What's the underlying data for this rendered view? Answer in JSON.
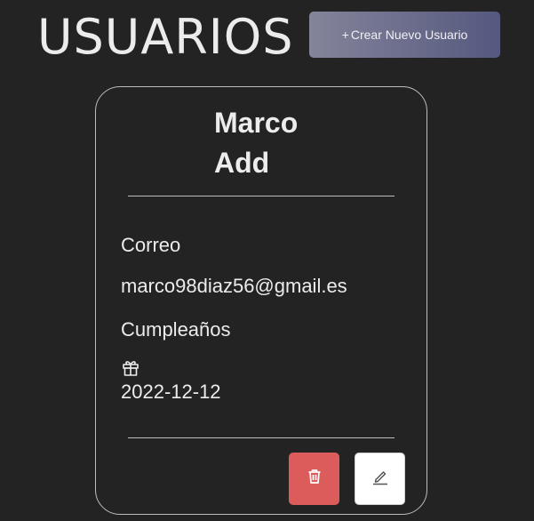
{
  "header": {
    "title": "USUARIOS",
    "create_button": {
      "icon": "+",
      "label": "Crear Nuevo Usuario"
    }
  },
  "user_card": {
    "name_first": "Marco",
    "name_last": "Add",
    "email_label": "Correo",
    "email": "marco98diaz56@gmail.es",
    "birthday_label": "Cumpleaños",
    "birthday_icon": "gift-icon",
    "birthday": "2022-12-12",
    "delete_icon": "trash-icon",
    "edit_icon": "pencil-icon"
  },
  "colors": {
    "background": "#232323",
    "delete_button": "#dc5c5c",
    "edit_button": "#ffffff",
    "create_button_gradient": [
      "#84849a",
      "#55587f"
    ],
    "card_border": "#bdbdbd"
  }
}
